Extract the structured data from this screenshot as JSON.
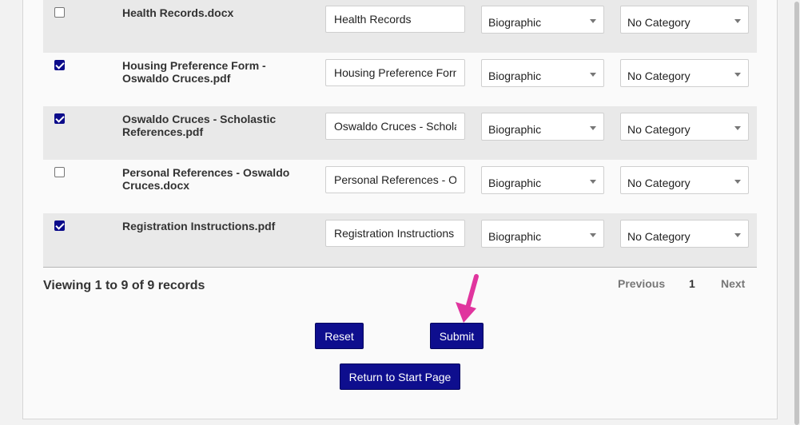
{
  "documents": [
    {
      "checked": false,
      "filename": "Health Records.docx",
      "title_value": "Health Records",
      "type": "Biographic",
      "category": "No Category"
    },
    {
      "checked": true,
      "filename": "Housing Preference Form - Oswaldo Cruces.pdf",
      "title_value": "Housing Preference Forn",
      "type": "Biographic",
      "category": "No Category"
    },
    {
      "checked": true,
      "filename": "Oswaldo Cruces - Scholastic References.pdf",
      "title_value": "Oswaldo Cruces - Schola",
      "type": "Biographic",
      "category": "No Category"
    },
    {
      "checked": false,
      "filename": "Personal References - Oswaldo Cruces.docx",
      "title_value": "Personal References - O",
      "type": "Biographic",
      "category": "No Category"
    },
    {
      "checked": true,
      "filename": "Registration Instructions.pdf",
      "title_value": "Registration Instructions",
      "type": "Biographic",
      "category": "No Category"
    }
  ],
  "footer": {
    "viewing_text": "Viewing 1 to 9 of 9 records",
    "pager": {
      "previous": "Previous",
      "current_page": "1",
      "next": "Next"
    }
  },
  "buttons": {
    "reset": "Reset",
    "submit": "Submit",
    "return_start": "Return to Start Page"
  },
  "colors": {
    "button_bg": "#0e0e8e",
    "checkbox_checked": "#0b0b8a",
    "pointer_arrow": "#e0359e"
  }
}
